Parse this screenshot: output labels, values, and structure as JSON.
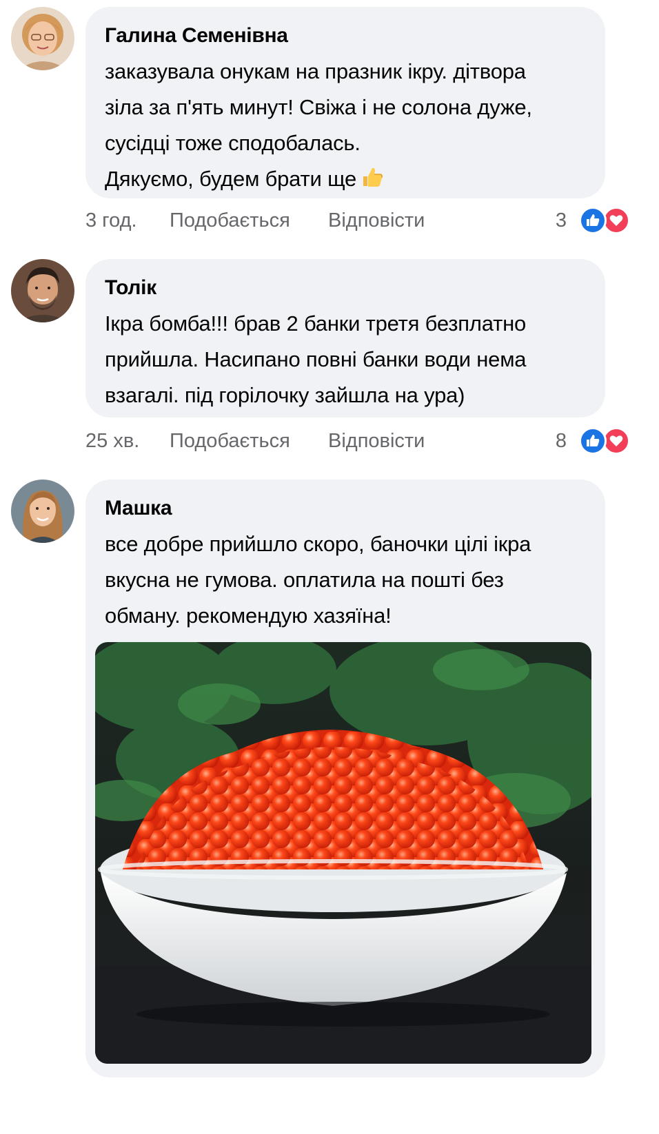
{
  "comments": [
    {
      "author": "Галина Семенівна",
      "text": "заказувала онукам на празник ікру. дітвора\nзіла за п'ять минут! Свіжа і не солона дуже,\nсусідці тоже сподобалась.\nДякуємо, будем брати ще",
      "emoji": "thumbs-up-icon",
      "time": "3 год.",
      "like_label": "Подобається",
      "reply_label": "Відповісти",
      "reaction_count": "3"
    },
    {
      "author": "Толік",
      "text": "Ікра бомба!!! брав 2 банки третя безплатно\nприйшла. Насипано повні банки води нема\nвзагалі. під горілочку зайшла на ура)",
      "time": "25 хв.",
      "like_label": "Подобається",
      "reply_label": "Відповісти",
      "reaction_count": "8"
    },
    {
      "author": "Машка",
      "text": "все добре прийшло скоро, баночки цілі ікра\nвкусна не гумова. оплатила на пошті без\nобману. рекомендую хазяїна!",
      "attachment": "red-caviar-bowl-photo"
    }
  ],
  "colors": {
    "bubble": "#f0f2f5",
    "meta_text": "#65676b",
    "like_blue": "#1b74e4",
    "love_red": "#f33e58"
  }
}
